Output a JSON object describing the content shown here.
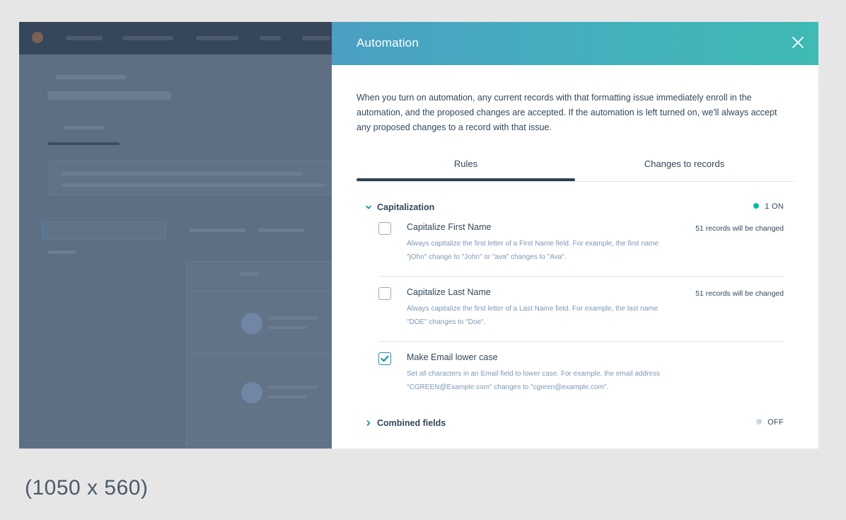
{
  "modal": {
    "title": "Automation",
    "intro": "When you turn on automation, any current records with that formatting issue immediately enroll in the automation, and the proposed changes are accepted. If the automation is left turned on, we'll always accept any proposed changes to a record with that issue.",
    "tabs": [
      {
        "label": "Rules",
        "active": true
      },
      {
        "label": "Changes to records",
        "active": false
      }
    ],
    "sections": [
      {
        "label": "Capitalization",
        "expanded": true,
        "status": "1 ON",
        "status_color": "#00bda5",
        "rules": [
          {
            "title": "Capitalize First Name",
            "description": "Always capitalize the first letter of a First Name field. For example, the first name \"jOhn\" change to \"John\" or \"ava\" changes to \"Ava\".",
            "count": "51 records will be changed",
            "checked": false
          },
          {
            "title": "Capitalize Last Name",
            "description": "Always capitalize the first letter of a Last Name field. For example, the last name \"DOE\" changes to \"Doe\".",
            "count": "51 records will be changed",
            "checked": false
          },
          {
            "title": "Make Email lower case",
            "description": "Set all characters in an Email field to lower case. For example, the email address \"CGREEN@Example.com\" changes to \"cgreen@example.com\".",
            "count": "",
            "checked": true
          }
        ]
      },
      {
        "label": "Combined fields",
        "expanded": false,
        "status": "OFF",
        "status_color": "#cbd6e2"
      }
    ]
  },
  "caption": "(1050 x 560)",
  "colors": {
    "header_gradient_start": "#4b9fc2",
    "header_gradient_end": "#3fbab4",
    "text_primary": "#33475b",
    "text_secondary": "#7c98b6",
    "checkbox_checked": "#1f8cb8"
  },
  "icons": {
    "close": "close-icon",
    "expanded": "chevron-down-icon",
    "collapsed": "chevron-right-icon",
    "check": "checkmark-icon"
  }
}
